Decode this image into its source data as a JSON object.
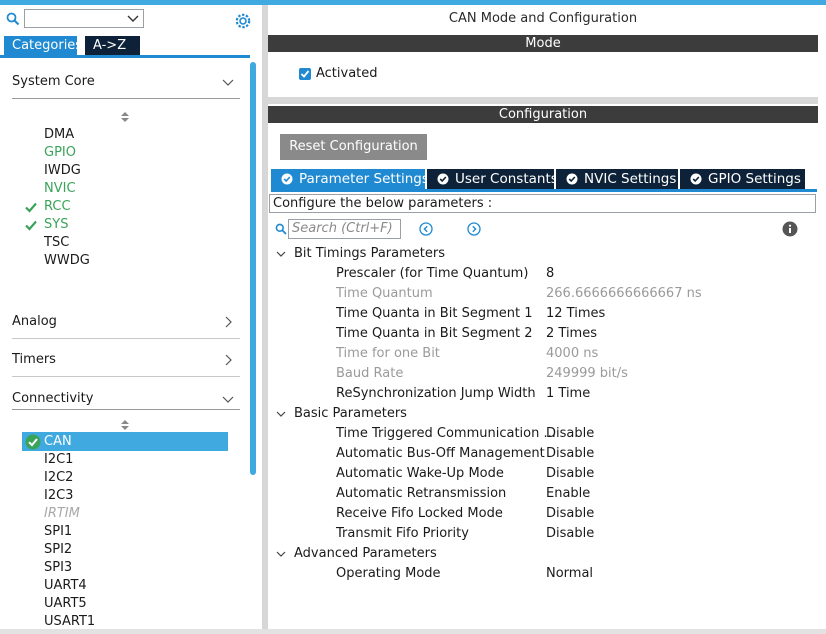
{
  "left": {
    "categories_tab": "Categories",
    "az_tab": "A->Z",
    "sections": {
      "system_core": "System Core",
      "analog": "Analog",
      "timers": "Timers",
      "connectivity": "Connectivity"
    },
    "system_core_items": [
      {
        "label": "DMA",
        "state": "normal"
      },
      {
        "label": "GPIO",
        "state": "green"
      },
      {
        "label": "IWDG",
        "state": "normal"
      },
      {
        "label": "NVIC",
        "state": "green"
      },
      {
        "label": "RCC",
        "state": "checked"
      },
      {
        "label": "SYS",
        "state": "checked"
      },
      {
        "label": "TSC",
        "state": "normal"
      },
      {
        "label": "WWDG",
        "state": "normal"
      }
    ],
    "connectivity_items": [
      {
        "label": "CAN",
        "state": "selected"
      },
      {
        "label": "I2C1",
        "state": "normal"
      },
      {
        "label": "I2C2",
        "state": "normal"
      },
      {
        "label": "I2C3",
        "state": "normal"
      },
      {
        "label": "IRTIM",
        "state": "disabled"
      },
      {
        "label": "SPI1",
        "state": "normal"
      },
      {
        "label": "SPI2",
        "state": "normal"
      },
      {
        "label": "SPI3",
        "state": "normal"
      },
      {
        "label": "UART4",
        "state": "normal"
      },
      {
        "label": "UART5",
        "state": "normal"
      },
      {
        "label": "USART1",
        "state": "normal"
      }
    ]
  },
  "right": {
    "title": "CAN Mode and Configuration",
    "mode_band": "Mode",
    "activated_label": "Activated",
    "config_band": "Configuration",
    "reset_button": "Reset Configuration",
    "tabs": [
      "Parameter Settings",
      "User Constants",
      "NVIC Settings",
      "GPIO Settings"
    ],
    "configure_label": "Configure the below parameters :",
    "search_placeholder": "Search (Ctrl+F)",
    "groups": [
      {
        "name": "Bit Timings Parameters",
        "params": [
          {
            "label": "Prescaler (for Time Quantum)",
            "value": "8",
            "muted": false
          },
          {
            "label": "Time Quantum",
            "value": "266.6666666666667 ns",
            "muted": true
          },
          {
            "label": "Time Quanta in Bit Segment 1",
            "value": "12 Times",
            "muted": false
          },
          {
            "label": "Time Quanta in Bit Segment 2",
            "value": "2 Times",
            "muted": false
          },
          {
            "label": "Time for one Bit",
            "value": "4000 ns",
            "muted": true
          },
          {
            "label": "Baud Rate",
            "value": "249999 bit/s",
            "muted": true
          },
          {
            "label": "ReSynchronization Jump Width",
            "value": "1 Time",
            "muted": false
          }
        ]
      },
      {
        "name": "Basic Parameters",
        "params": [
          {
            "label": "Time Triggered Communication ...",
            "value": "Disable",
            "muted": false
          },
          {
            "label": "Automatic Bus-Off Management",
            "value": "Disable",
            "muted": false
          },
          {
            "label": "Automatic Wake-Up Mode",
            "value": "Disable",
            "muted": false
          },
          {
            "label": "Automatic Retransmission",
            "value": "Enable",
            "muted": false
          },
          {
            "label": "Receive Fifo Locked Mode",
            "value": "Disable",
            "muted": false
          },
          {
            "label": "Transmit Fifo Priority",
            "value": "Disable",
            "muted": false
          }
        ]
      },
      {
        "name": "Advanced Parameters",
        "params": [
          {
            "label": "Operating Mode",
            "value": "Normal",
            "muted": false
          }
        ]
      }
    ]
  }
}
